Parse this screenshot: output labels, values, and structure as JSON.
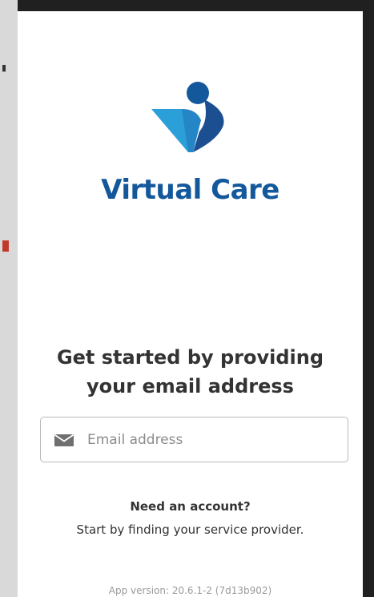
{
  "brand": {
    "name": "Virtual Care",
    "color_primary": "#14589c",
    "color_secondary": "#2b9fd8",
    "color_dark": "#1c4f91"
  },
  "signin": {
    "headline": "Get started by providing your email address",
    "email_placeholder": "Email address",
    "email_value": "",
    "email_icon": "envelope-icon"
  },
  "signup": {
    "prompt": "Need an account?",
    "link_text": "Start by finding your service provider."
  },
  "footer": {
    "app_version": "App version: 20.6.1-2 (7d13b902)"
  }
}
